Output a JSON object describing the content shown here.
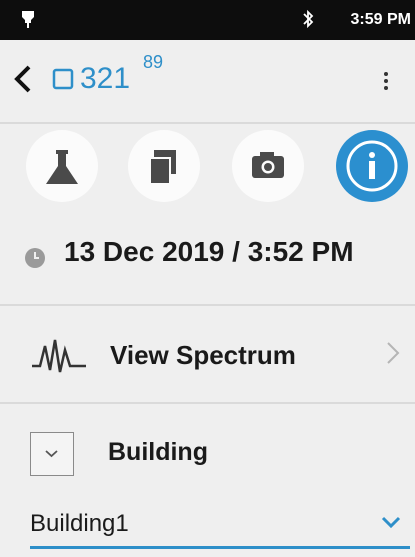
{
  "status_bar": {
    "time": "3:59 PM",
    "icons": [
      "notification-icon",
      "bluetooth-icon"
    ]
  },
  "app_bar": {
    "item_id": "321",
    "item_superscript": "89",
    "icons": [
      "back-icon",
      "item-icon",
      "more-icon"
    ]
  },
  "actions": [
    {
      "icon": "flask-icon",
      "active": false
    },
    {
      "icon": "copy-icon",
      "active": false
    },
    {
      "icon": "camera-icon",
      "active": false
    },
    {
      "icon": "info-icon",
      "active": true
    }
  ],
  "timestamp": {
    "text": "13 Dec 2019 / 3:52 PM",
    "icon": "clock-icon"
  },
  "spectrum": {
    "label": "View Spectrum",
    "icon": "spectrum-icon"
  },
  "building": {
    "label": "Building",
    "value": "Building1"
  },
  "colors": {
    "accent": "#2e8fc9",
    "status_bar": "#0d0d0d",
    "background": "#efefef"
  }
}
